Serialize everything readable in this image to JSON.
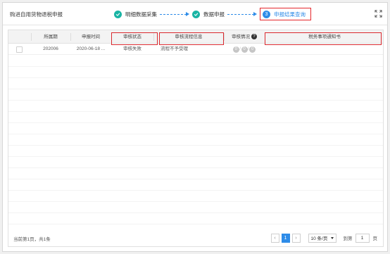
{
  "header": {
    "title": "购进自用货物退税申报",
    "steps": [
      {
        "label": "明细数据采集",
        "state": "done"
      },
      {
        "label": "数据申报",
        "state": "done"
      },
      {
        "label": "申报结果查询",
        "state": "active",
        "number": "3"
      }
    ]
  },
  "table": {
    "columns": {
      "period": "所属期",
      "declare_time": "申报时间",
      "audit_status": "审核状态",
      "audit_flow": "审核流程信息",
      "audit_result": "审核情况",
      "notice": "税务事项通知书"
    },
    "rows": [
      {
        "period": "202006",
        "declare_time": "2020-06-18 ...",
        "audit_status": "审核失败",
        "audit_flow": "流程不予受理",
        "result_badges": [
          "0",
          "0",
          "0"
        ],
        "notice": ""
      }
    ]
  },
  "footer": {
    "summary": "当前第1页，共1条",
    "current_page": "1",
    "page_size": "10 条/页",
    "goto_label": "到第",
    "goto_value": "1",
    "page_suffix": "页"
  },
  "colors": {
    "accent": "#2e8ce8",
    "done": "#19b4a4",
    "highlight": "#d9282e"
  }
}
